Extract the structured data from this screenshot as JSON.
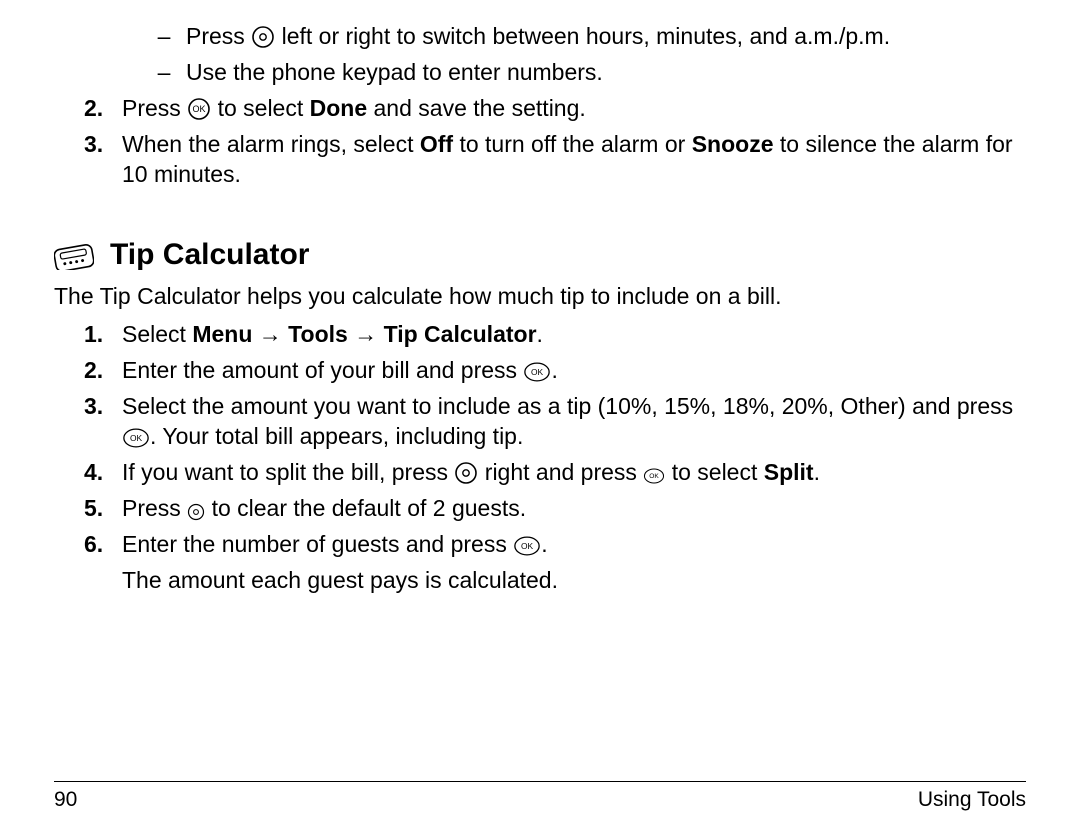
{
  "sub_bullets": [
    {
      "pre": "Press ",
      "icon": "nav-ring",
      "post": " left or right to switch between hours, minutes, and a.m./p.m."
    },
    {
      "pre": "Use the phone keypad to enter numbers.",
      "icon": null,
      "post": ""
    }
  ],
  "top_steps": [
    {
      "num": "2.",
      "segments": [
        {
          "t": "Press "
        },
        {
          "icon": "ok-circle-sm"
        },
        {
          "t": " to select "
        },
        {
          "bold": "Done"
        },
        {
          "t": " and save the setting."
        }
      ]
    },
    {
      "num": "3.",
      "segments": [
        {
          "t": "When the alarm rings, select "
        },
        {
          "bold": "Off"
        },
        {
          "t": " to turn off the alarm or "
        },
        {
          "bold": "Snooze"
        },
        {
          "t": " to silence the alarm for 10 minutes."
        }
      ]
    }
  ],
  "section_heading": "Tip Calculator",
  "section_intro": "The Tip Calculator helps you calculate how much tip to include on a bill.",
  "tip_steps": [
    {
      "num": "1.",
      "segments": [
        {
          "t": "Select "
        },
        {
          "bold": "Menu"
        },
        {
          "t": " "
        },
        {
          "arrow": true
        },
        {
          "t": " "
        },
        {
          "bold": "Tools"
        },
        {
          "t": " "
        },
        {
          "arrow": true
        },
        {
          "t": " "
        },
        {
          "bold": "Tip Calculator"
        },
        {
          "t": "."
        }
      ]
    },
    {
      "num": "2.",
      "segments": [
        {
          "t": "Enter the amount of your bill and press "
        },
        {
          "icon": "ok-oval"
        },
        {
          "t": "."
        }
      ]
    },
    {
      "num": "3.",
      "segments": [
        {
          "t": "Select the amount you want to include as a tip (10%, 15%, 18%, 20%, Other) and press "
        },
        {
          "icon": "ok-oval"
        },
        {
          "t": ". Your total bill appears, including tip."
        }
      ]
    },
    {
      "num": "4.",
      "segments": [
        {
          "t": "If you want to split the bill, press "
        },
        {
          "icon": "nav-ring"
        },
        {
          "t": " right and press "
        },
        {
          "icon": "ok-oval-sm"
        },
        {
          "t": " to select "
        },
        {
          "bold": "Split"
        },
        {
          "t": "."
        }
      ]
    },
    {
      "num": "5.",
      "segments": [
        {
          "t": "Press "
        },
        {
          "icon": "nav-ring-sm"
        },
        {
          "t": " to clear the default of 2 guests."
        }
      ]
    },
    {
      "num": "6.",
      "segments": [
        {
          "t": "Enter the number of guests and press "
        },
        {
          "icon": "ok-oval"
        },
        {
          "t": "."
        }
      ],
      "after": "The amount each guest pays is calculated."
    }
  ],
  "footer": {
    "page": "90",
    "section": "Using Tools"
  }
}
